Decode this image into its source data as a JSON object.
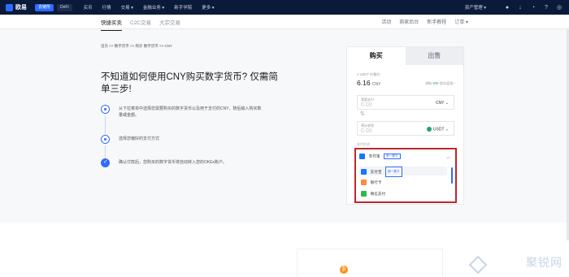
{
  "topnav": {
    "logo": "欧易",
    "pill_active": "去链所",
    "pill_defi": "DeFi",
    "links": [
      "买币",
      "行情",
      "交易 ▾",
      "金融业务 ▾",
      "新手学院",
      "更多 ▾"
    ],
    "assets": "资产管理 ▾"
  },
  "subnav": {
    "tabs": [
      "快捷买卖",
      "C2C交易",
      "大宗交易"
    ],
    "links": [
      "活动",
      "商家后台",
      "新手教程",
      "订单 ▾"
    ]
  },
  "breadcrumb": "首页 >> 数字货币 >> 购买 数字货币 >> CNY",
  "headline": "不知道如何使用CNY购买数字货币? 仅需简单三步!",
  "steps": [
    "从下拉菜单中选择您需要购买的数字货币以及用于支付的CNY，随后输入购买数量或金额。",
    "选择您偏好的支付方式",
    "确认付款后，您购买的数字货币将自动转入您的OKEx账户。"
  ],
  "card": {
    "tab_buy": "购买",
    "tab_sell": "出售",
    "rate_label": "1 USDT 价格约",
    "rate_value": "6.16",
    "rate_unit": "CNY",
    "promo_prefix": "领取",
    "promo_amount": "¥20",
    "promo_suffix": "首次返现 ›",
    "spend_label": "我要支付",
    "spend_placeholder": "0.00",
    "spend_currency": "CNY ⌄",
    "receive_label": "预计收到",
    "receive_placeholder": "0.00",
    "receive_currency": "USDT ⌄",
    "payment_label": "支付方式"
  },
  "dropdown": {
    "selected": "支付宝",
    "badge": "新一要卡",
    "options": [
      {
        "name": "支付宝",
        "badge": "新一要卡",
        "icon": "alipay-icon"
      },
      {
        "name": "银行卡",
        "badge": "",
        "icon": "bank-card-icon"
      },
      {
        "name": "微信支付",
        "badge": "",
        "icon": "wechat-pay-icon"
      }
    ]
  },
  "watermark": "聚锐网",
  "colors": {
    "nav_bg": "#0a1a3a",
    "accent": "#2f6bff",
    "highlight_border": "#c0262d",
    "usdt": "#26a17b"
  }
}
